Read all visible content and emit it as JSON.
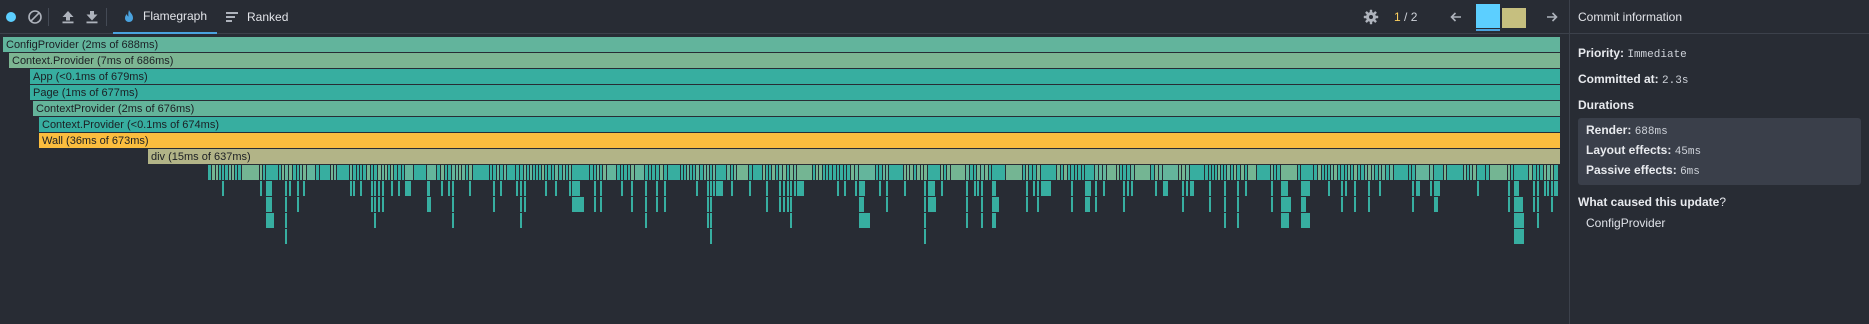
{
  "toolbar": {
    "record_icon": "record-icon",
    "clear_icon": "clear-icon",
    "upload_icon": "upload-icon",
    "download_icon": "download-icon",
    "tabs": [
      {
        "label": "Flamegraph",
        "icon": "flame-icon",
        "active": true
      },
      {
        "label": "Ranked",
        "icon": "ranked-icon",
        "active": false
      }
    ],
    "commit": {
      "current": "1",
      "separator": " / ",
      "total": "2"
    },
    "commit_bars": [
      {
        "color": "#5ccfff",
        "selected": true,
        "height": 1.0
      },
      {
        "color": "#c6bf7f",
        "selected": false,
        "height": 0.85
      }
    ]
  },
  "colors": {
    "background": "#282c34",
    "teal": "#37aea0",
    "teal_light": "#64b59c",
    "sage": "#74b593",
    "olive": "#b1b487",
    "highlight_yellow": "#fbbd3e",
    "accent_blue": "#4aa3df"
  },
  "flamegraph": {
    "rows": [
      {
        "label": "ConfigProvider (2ms of 688ms)",
        "color": "#62b49c"
      },
      {
        "label": "Context.Provider (7ms of 686ms)",
        "color": "#7cb592"
      },
      {
        "label": "App (<0.1ms of 679ms)",
        "color": "#37aea0"
      },
      {
        "label": "Page (1ms of 677ms)",
        "color": "#37aea0"
      },
      {
        "label": "ContextProvider (2ms of 676ms)",
        "color": "#64b49a"
      },
      {
        "label": "Context.Provider (<0.1ms of 674ms)",
        "color": "#37aea0"
      },
      {
        "label": "Wall (36ms of 673ms)",
        "color": "#fbbd3e"
      },
      {
        "label": "div (15ms of 637ms)",
        "color": "#b2b487"
      }
    ]
  },
  "sidebar": {
    "title": "Commit information",
    "priority_label": "Priority",
    "priority_value": "Immediate",
    "committed_label": "Committed at",
    "committed_value": "2.3s",
    "durations_title": "Durations",
    "durations": [
      {
        "label": "Render",
        "value": "688ms"
      },
      {
        "label": "Layout effects",
        "value": "45ms"
      },
      {
        "label": "Passive effects",
        "value": "6ms"
      }
    ],
    "cause_title": "What caused this update",
    "cause_suffix": "?",
    "causes": [
      "ConfigProvider"
    ]
  }
}
